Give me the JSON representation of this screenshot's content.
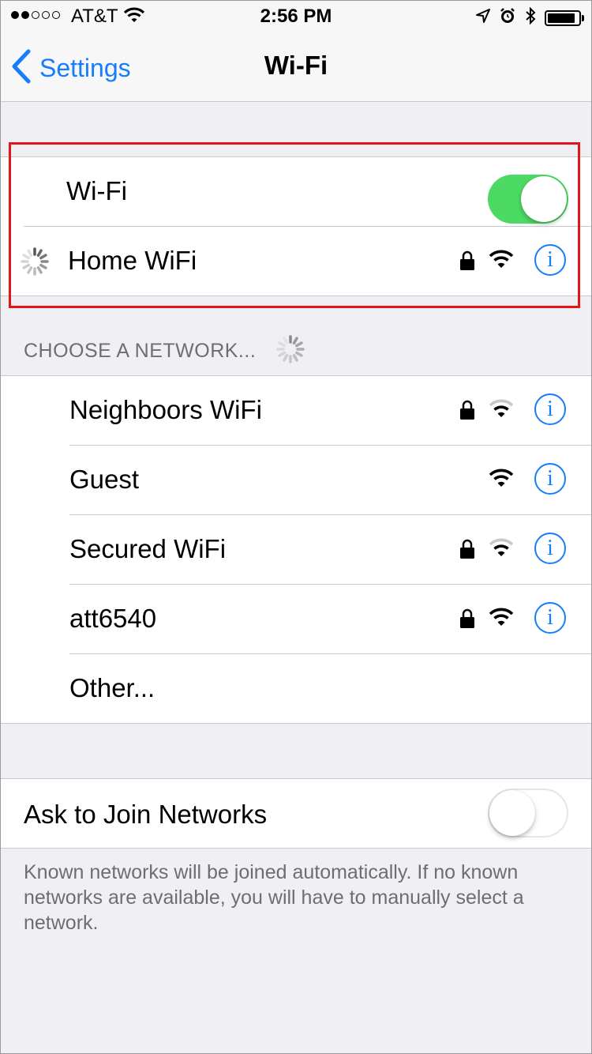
{
  "status_bar": {
    "carrier": "AT&T",
    "time": "2:56 PM",
    "signal_bars_filled": 2,
    "signal_bars_total": 5
  },
  "nav": {
    "back_label": "Settings",
    "title": "Wi-Fi"
  },
  "wifi_toggle": {
    "label": "Wi-Fi",
    "on": true
  },
  "connected_network": {
    "name": "Home WiFi",
    "secured": true,
    "status": "connecting"
  },
  "network_section": {
    "header": "CHOOSE A NETWORK..."
  },
  "networks": [
    {
      "name": "Neighboors WiFi",
      "secured": true
    },
    {
      "name": "Guest",
      "secured": false
    },
    {
      "name": "Secured WiFi",
      "secured": true
    },
    {
      "name": "att6540",
      "secured": true
    }
  ],
  "other_label": "Other...",
  "ask_to_join": {
    "label": "Ask to Join Networks",
    "on": false
  },
  "footer_text": "Known networks will be joined automatically. If no known networks are available, you will have to manually select a network.",
  "colors": {
    "accent": "#157efb",
    "toggle_on": "#4cd964",
    "highlight": "#e3151b"
  },
  "info_glyph": "i"
}
